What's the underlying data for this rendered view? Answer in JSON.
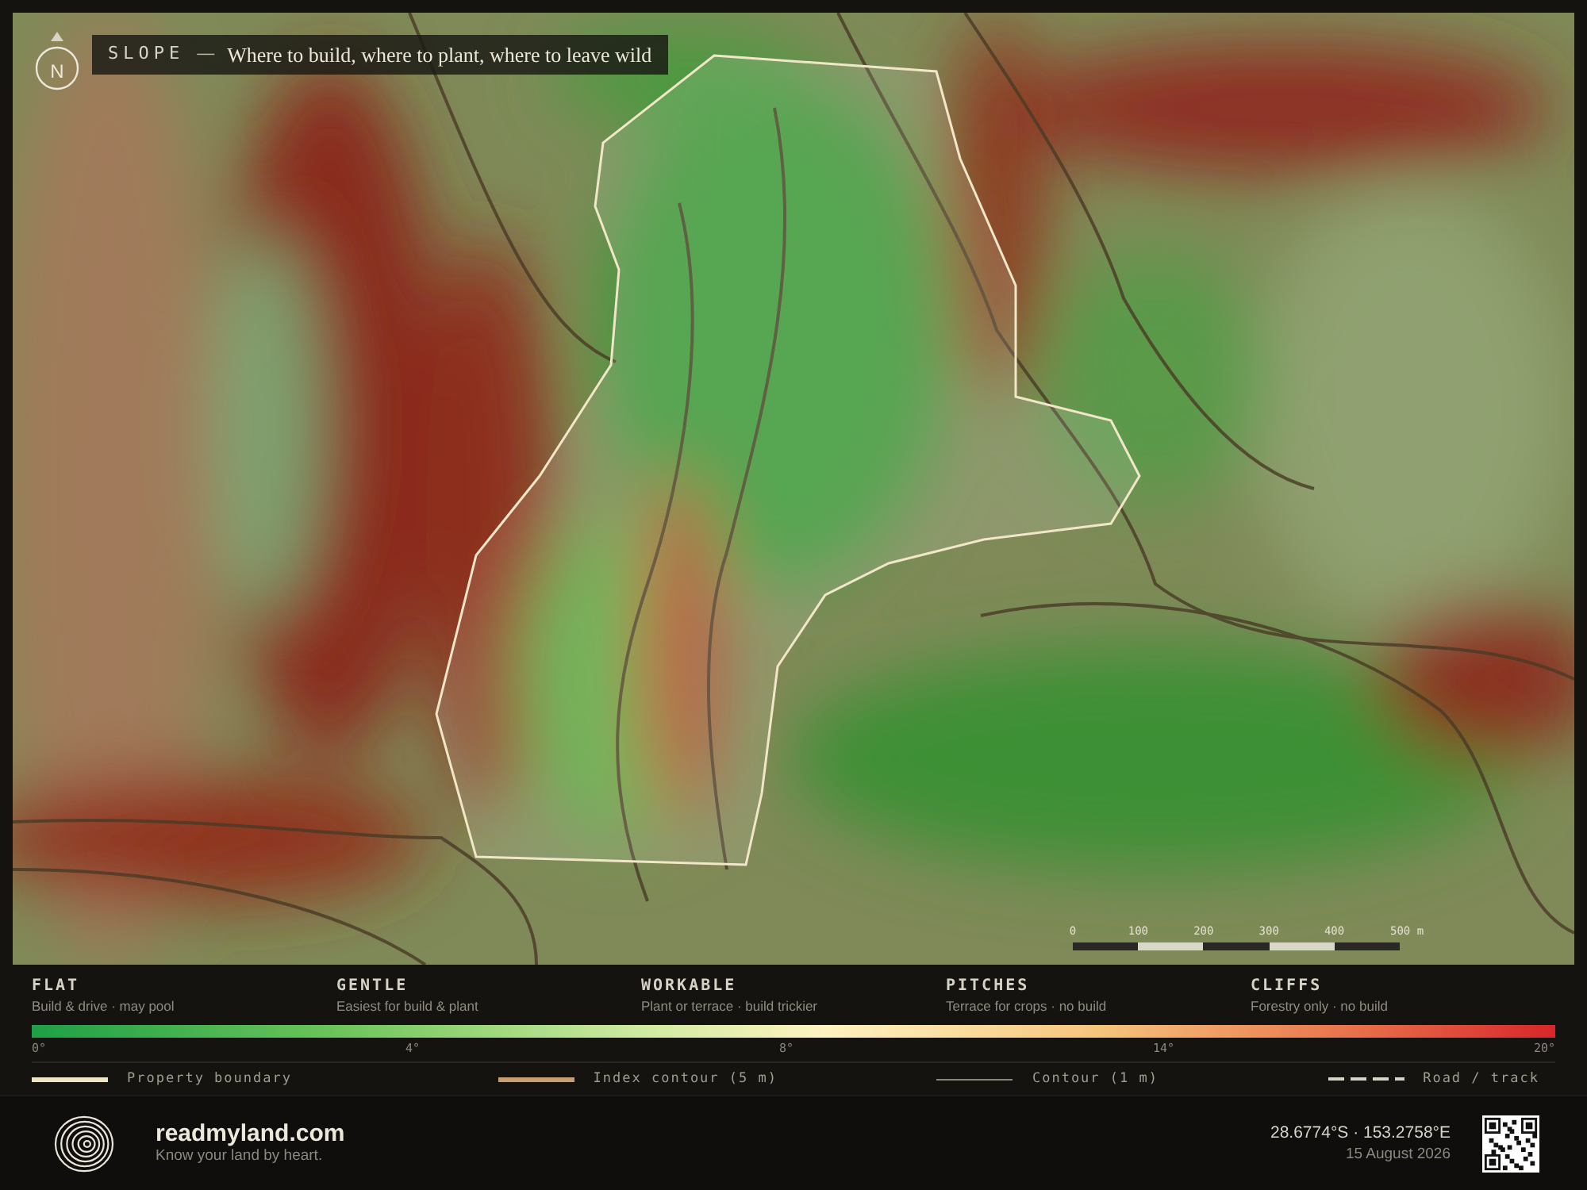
{
  "header": {
    "north_label": "N",
    "title": "SLOPE",
    "separator": "—",
    "subtitle": "Where to build, where to plant, where to leave wild"
  },
  "scale_bar": {
    "ticks": [
      "0",
      "100",
      "200",
      "300",
      "400",
      "500 m"
    ]
  },
  "slope_classes": [
    {
      "name": "FLAT",
      "description": "Build & drive · may pool"
    },
    {
      "name": "GENTLE",
      "description": "Easiest for build & plant"
    },
    {
      "name": "WORKABLE",
      "description": "Plant or terrace · build trickier"
    },
    {
      "name": "PITCHES",
      "description": "Terrace for crops · no build"
    },
    {
      "name": "CLIFFS",
      "description": "Forestry only · no build"
    }
  ],
  "gradient_ticks": [
    "0°",
    "4°",
    "8°",
    "14°",
    "20°"
  ],
  "line_legend": [
    {
      "kind": "boundary",
      "label": "Property boundary"
    },
    {
      "kind": "index",
      "label": "Index contour (5 m)"
    },
    {
      "kind": "contour",
      "label": "Contour (1 m)"
    },
    {
      "kind": "road",
      "label": "Road / track"
    }
  ],
  "footer": {
    "brand": "readmyland.com",
    "tagline": "Know your land by heart.",
    "coordinates": "28.6774°S · 153.2758°E",
    "date": "15 August 2026"
  }
}
